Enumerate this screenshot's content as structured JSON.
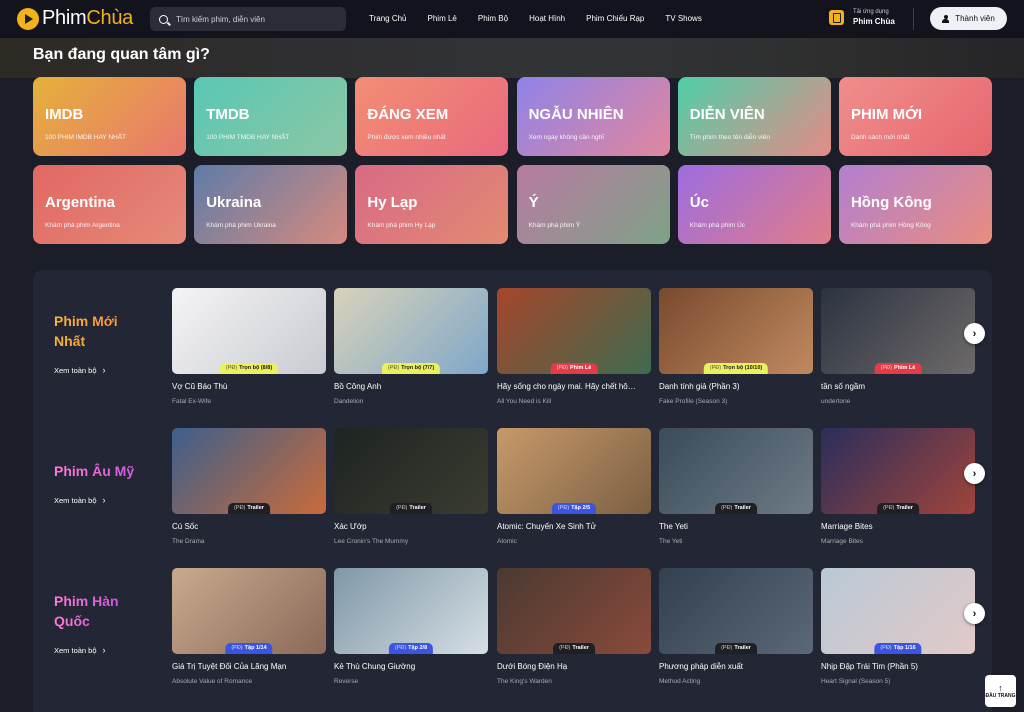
{
  "header": {
    "logo_brand": "Phim",
    "logo_accent": "Chùa",
    "search_placeholder": "Tìm kiếm phim, diễn viên",
    "nav": [
      "Trang Chủ",
      "Phim Lẻ",
      "Phim Bộ",
      "Hoạt Hình",
      "Phim Chiếu Rạp",
      "TV Shows"
    ],
    "app_small": "Tải ứng dụng",
    "app_big": "Phim Chùa",
    "member_label": "Thành viên"
  },
  "section_title": "Bạn đang quan tâm gì?",
  "topics": [
    {
      "title": "IMDB",
      "sub": "100 PHIM IMDB HAY NHẤT",
      "colors": [
        "#e5b13a",
        "#e9776f"
      ]
    },
    {
      "title": "TMDB",
      "sub": "100 PHIM TMDB HAY NHẤT",
      "colors": [
        "#59c7b4",
        "#8cc7a4"
      ]
    },
    {
      "title": "ĐÁNG XEM",
      "sub": "Phim được xem nhiều nhất",
      "colors": [
        "#f28e73",
        "#e96a7e"
      ]
    },
    {
      "title": "NGẪU NHIÊN",
      "sub": "Xem ngay không cần nghĩ",
      "colors": [
        "#8f83e9",
        "#e2869c"
      ]
    },
    {
      "title": "DIỄN VIÊN",
      "sub": "Tìm phim theo tên diễn viên",
      "colors": [
        "#4fcfa8",
        "#e58a86"
      ]
    },
    {
      "title": "PHIM MỚI",
      "sub": "Danh sách mới nhất",
      "colors": [
        "#ef8e8c",
        "#e6676f"
      ]
    },
    {
      "title": "Argentina",
      "sub": "Khám phá phim Argentina",
      "colors": [
        "#e26863",
        "#e48a78"
      ]
    },
    {
      "title": "Ukraina",
      "sub": "Khám phá phim Ukraina",
      "colors": [
        "#5f7ca8",
        "#d58a7e"
      ]
    },
    {
      "title": "Hy Lạp",
      "sub": "Khám phá phim Hy Lạp",
      "colors": [
        "#d86a86",
        "#e28a72"
      ]
    },
    {
      "title": "Ý",
      "sub": "Khám phá phim Ý",
      "colors": [
        "#b97aa2",
        "#7ea286"
      ]
    },
    {
      "title": "Úc",
      "sub": "Khám phá phim Úc",
      "colors": [
        "#9c6de0",
        "#e17c8a"
      ]
    },
    {
      "title": "Hồng Kông",
      "sub": "Khám phá phim Hồng Kông",
      "colors": [
        "#b27fd0",
        "#e88d7f"
      ]
    }
  ],
  "rows": [
    {
      "title": "Phim Mới Nhất",
      "view_all": "Xem toàn bộ",
      "style": "gold",
      "cards": [
        {
          "title": "Vợ Cũ Báo Thù",
          "sub": "Fatal Ex-Wife",
          "pd": "(PĐ)",
          "badge": "Trọn bộ (8/8)",
          "badge_color": "yellow",
          "colors": [
            "#f4f4f6",
            "#c9cbd1"
          ]
        },
        {
          "title": "Bồ Công Anh",
          "sub": "Dandelion",
          "pd": "(PĐ)",
          "badge": "Trọn bộ (7/7)",
          "badge_color": "yellow",
          "colors": [
            "#d9d2b9",
            "#7ea7c9"
          ]
        },
        {
          "title": "Hãy sống cho ngày mai. Hãy chết hôm nay.",
          "sub": "All You Need is Kill",
          "pd": "(PĐ)",
          "badge": "Phim Lẻ",
          "badge_color": "red",
          "colors": [
            "#a5462a",
            "#3f6b4f"
          ]
        },
        {
          "title": "Danh tính giả (Phần 3)",
          "sub": "Fake Profile (Season 3)",
          "pd": "(PĐ)",
          "badge": "Trọn bộ (10/10)",
          "badge_color": "yellow",
          "colors": [
            "#7a4a2e",
            "#c08a60"
          ]
        },
        {
          "title": "tần số ngầm",
          "sub": "undertone",
          "pd": "(PĐ)",
          "badge": "Phim Lẻ",
          "badge_color": "red",
          "colors": [
            "#2c3340",
            "#6e6a6a"
          ]
        }
      ]
    },
    {
      "title": "Phim Âu Mỹ",
      "view_all": "Xem toàn bộ",
      "style": "pink",
      "cards": [
        {
          "title": "Cú Sốc",
          "sub": "The Drama",
          "pd": "(PĐ)",
          "badge": "Trailer",
          "badge_color": "dark",
          "colors": [
            "#3d5f8c",
            "#c96b3a"
          ]
        },
        {
          "title": "Xác Ướp",
          "sub": "Lee Cronin's The Mummy",
          "pd": "(PĐ)",
          "badge": "Trailer",
          "badge_color": "dark",
          "colors": [
            "#1e2422",
            "#3a3c30"
          ]
        },
        {
          "title": "Atomic: Chuyến Xe Sinh Tử",
          "sub": "Atomic",
          "pd": "(PĐ)",
          "badge": "Tập 2/5",
          "badge_color": "blue",
          "colors": [
            "#c69a6a",
            "#7c5f42"
          ]
        },
        {
          "title": "The Yeti",
          "sub": "The Yeti",
          "pd": "(PĐ)",
          "badge": "Trailer",
          "badge_color": "dark",
          "colors": [
            "#3a4b59",
            "#6d7b86"
          ]
        },
        {
          "title": "Marriage Bites",
          "sub": "Marriage Bites",
          "pd": "(PĐ)",
          "badge": "Trailer",
          "badge_color": "dark",
          "colors": [
            "#2a2e5c",
            "#a0443a"
          ]
        }
      ]
    },
    {
      "title": "Phim Hàn Quốc",
      "view_all": "Xem toàn bộ",
      "style": "pink",
      "cards": [
        {
          "title": "Giá Trị Tuyệt Đối Của Lãng Mạn",
          "sub": "Absolute Value of Romance",
          "pd": "(PĐ)",
          "badge": "Tập 1/14",
          "badge_color": "blue",
          "colors": [
            "#c9a98e",
            "#8a6a58"
          ]
        },
        {
          "title": "Kẻ Thù Chung Giường",
          "sub": "Reverse",
          "pd": "(PĐ)",
          "badge": "Tập 2/8",
          "badge_color": "blue",
          "colors": [
            "#7f97a6",
            "#d5dfe5"
          ]
        },
        {
          "title": "Dưới Bóng Điện Hạ",
          "sub": "The King's Warden",
          "pd": "(PĐ)",
          "badge": "Trailer",
          "badge_color": "dark",
          "colors": [
            "#4a3a32",
            "#8a4a3a"
          ]
        },
        {
          "title": "Phương pháp diễn xuất",
          "sub": "Method Acting",
          "pd": "(PĐ)",
          "badge": "Trailer",
          "badge_color": "dark",
          "colors": [
            "#32404f",
            "#5a6878"
          ]
        },
        {
          "title": "Nhịp Đập Trái Tim (Phần 5)",
          "sub": "Heart Signal (Season 5)",
          "pd": "(PĐ)",
          "badge": "Tập 1/16",
          "badge_color": "blue",
          "colors": [
            "#b9c9d6",
            "#e2c9c8"
          ]
        }
      ]
    }
  ],
  "to_top_label": "ĐẦU TRANG"
}
